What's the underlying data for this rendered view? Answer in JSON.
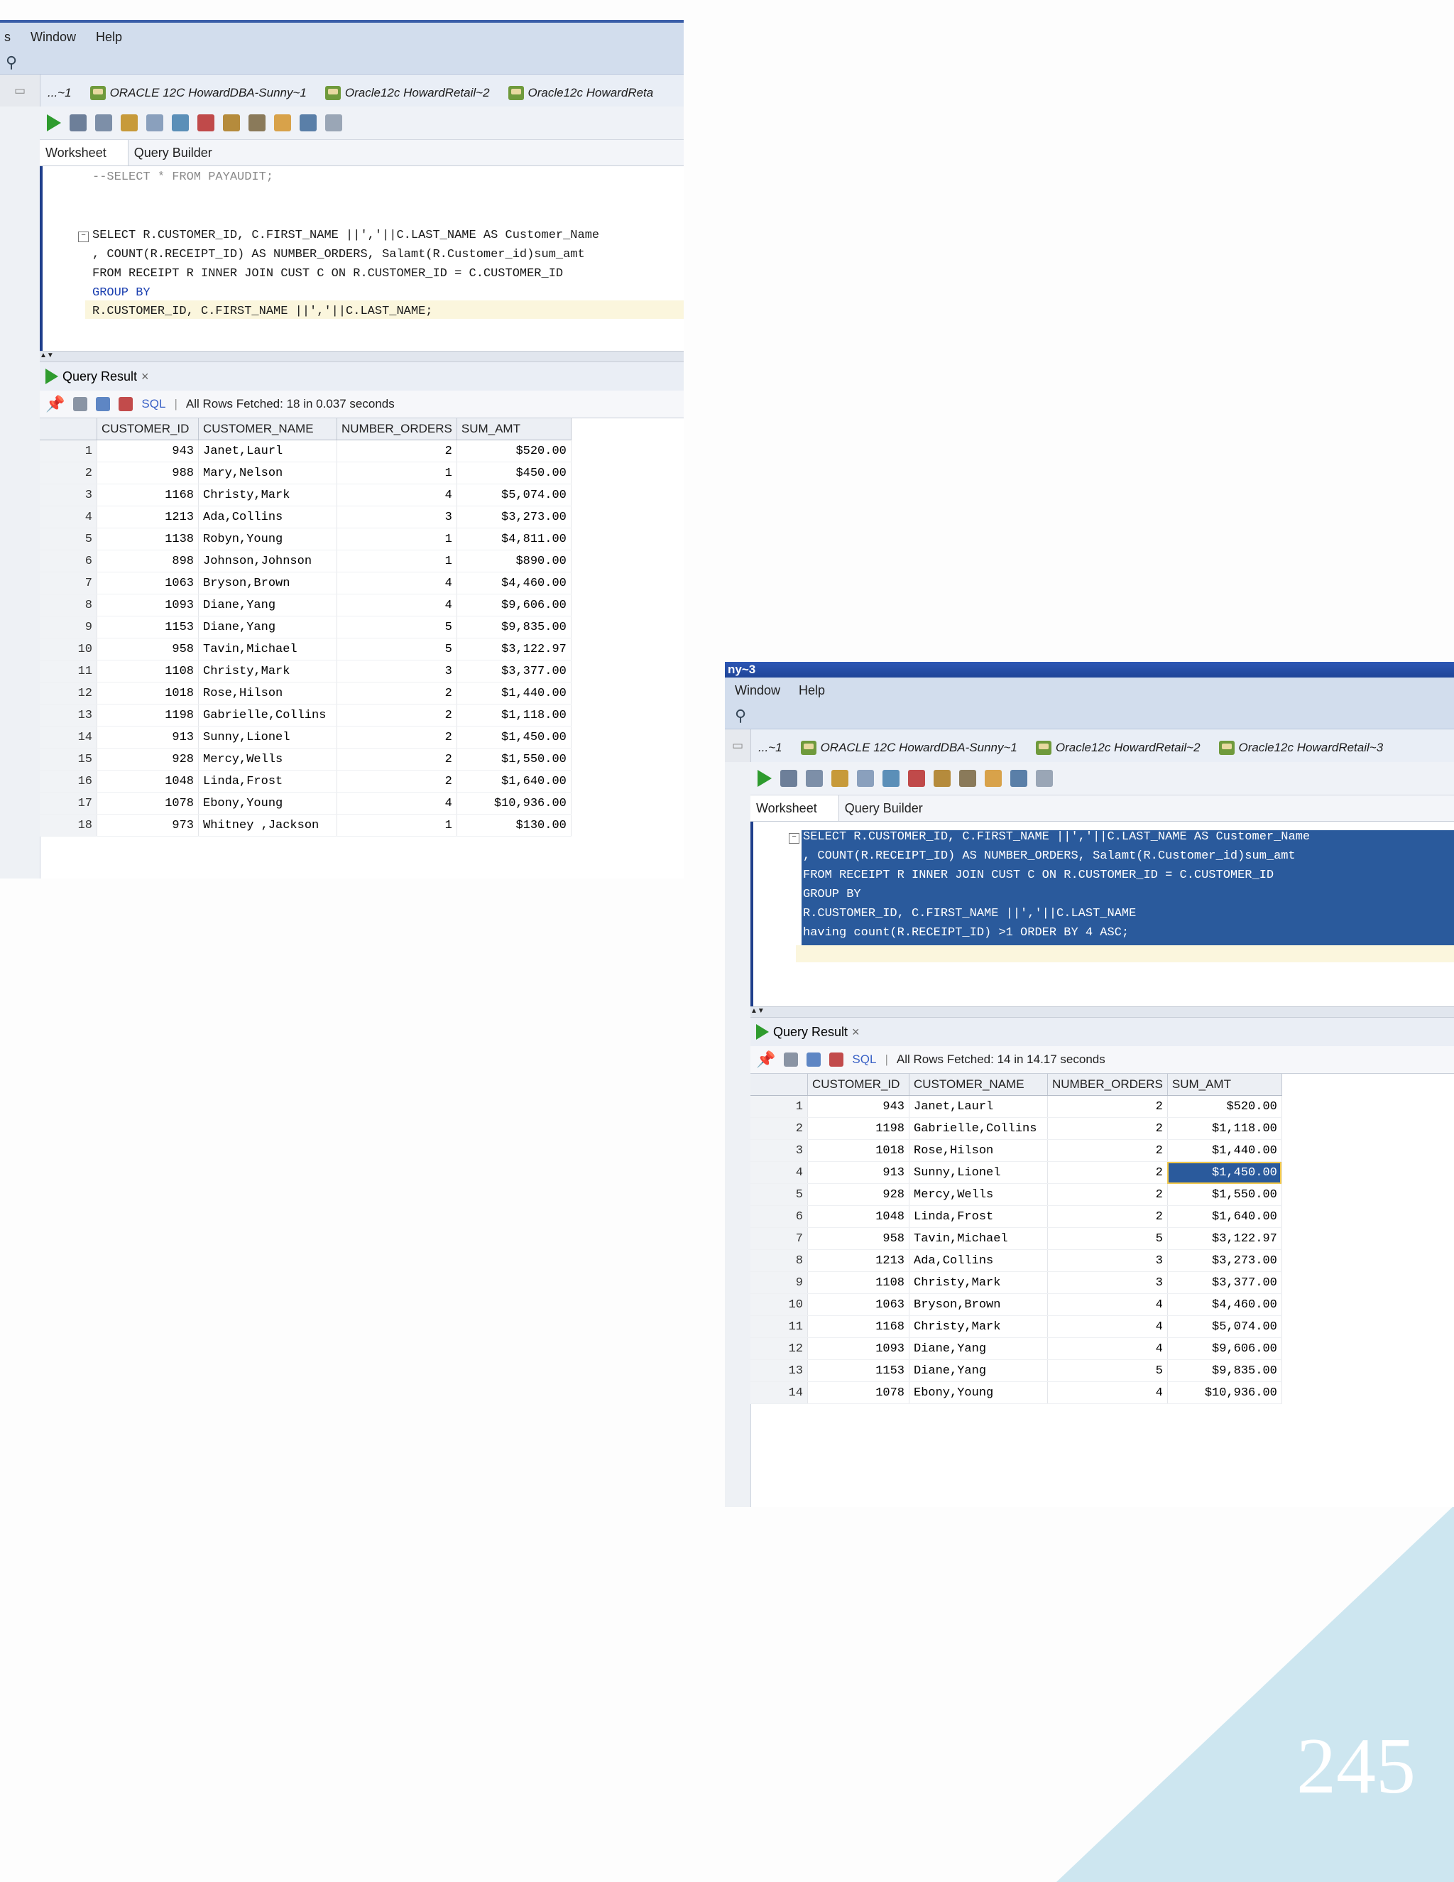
{
  "window1": {
    "menu": [
      "s",
      "Window",
      "Help"
    ],
    "tabs": [
      "...~1",
      "ORACLE 12C HowardDBA-Sunny~1",
      "Oracle12c HowardRetail~2",
      "Oracle12c HowardReta"
    ],
    "subtabs": [
      "Worksheet",
      "Query Builder"
    ],
    "sql": [
      "--SELECT * FROM PAYAUDIT;",
      "",
      "",
      "SELECT R.CUSTOMER_ID, C.FIRST_NAME ||','||C.LAST_NAME AS Customer_Name",
      ", COUNT(R.RECEIPT_ID) AS NUMBER_ORDERS, Salamt(R.Customer_id)sum_amt",
      "FROM RECEIPT R INNER JOIN CUST C ON R.CUSTOMER_ID = C.CUSTOMER_ID",
      "GROUP BY",
      "R.CUSTOMER_ID, C.FIRST_NAME ||','||C.LAST_NAME;"
    ],
    "result_tab": "Query Result",
    "sql_label": "SQL",
    "status": "All Rows Fetched: 18 in 0.037 seconds",
    "columns": [
      "CUSTOMER_ID",
      "CUSTOMER_NAME",
      "NUMBER_ORDERS",
      "SUM_AMT"
    ],
    "rows": [
      [
        "1",
        "943",
        "Janet,Laurl",
        "2",
        "$520.00"
      ],
      [
        "2",
        "988",
        "Mary,Nelson",
        "1",
        "$450.00"
      ],
      [
        "3",
        "1168",
        "Christy,Mark",
        "4",
        "$5,074.00"
      ],
      [
        "4",
        "1213",
        "Ada,Collins",
        "3",
        "$3,273.00"
      ],
      [
        "5",
        "1138",
        "Robyn,Young",
        "1",
        "$4,811.00"
      ],
      [
        "6",
        "898",
        "Johnson,Johnson",
        "1",
        "$890.00"
      ],
      [
        "7",
        "1063",
        "Bryson,Brown",
        "4",
        "$4,460.00"
      ],
      [
        "8",
        "1093",
        "Diane,Yang",
        "4",
        "$9,606.00"
      ],
      [
        "9",
        "1153",
        "Diane,Yang",
        "5",
        "$9,835.00"
      ],
      [
        "10",
        "958",
        "Tavin,Michael",
        "5",
        "$3,122.97"
      ],
      [
        "11",
        "1108",
        "Christy,Mark",
        "3",
        "$3,377.00"
      ],
      [
        "12",
        "1018",
        "Rose,Hilson",
        "2",
        "$1,440.00"
      ],
      [
        "13",
        "1198",
        "Gabrielle,Collins",
        "2",
        "$1,118.00"
      ],
      [
        "14",
        "913",
        "Sunny,Lionel",
        "2",
        "$1,450.00"
      ],
      [
        "15",
        "928",
        "Mercy,Wells",
        "2",
        "$1,550.00"
      ],
      [
        "16",
        "1048",
        "Linda,Frost",
        "2",
        "$1,640.00"
      ],
      [
        "17",
        "1078",
        "Ebony,Young",
        "4",
        "$10,936.00"
      ],
      [
        "18",
        "973",
        "Whitney ,Jackson",
        "1",
        "$130.00"
      ]
    ]
  },
  "window2": {
    "title": "ny~3",
    "menu": [
      "Window",
      "Help"
    ],
    "tabs": [
      "...~1",
      "ORACLE 12C HowardDBA-Sunny~1",
      "Oracle12c HowardRetail~2",
      "Oracle12c HowardRetail~3"
    ],
    "subtabs": [
      "Worksheet",
      "Query Builder"
    ],
    "sql": [
      "SELECT R.CUSTOMER_ID, C.FIRST_NAME ||','||C.LAST_NAME AS Customer_Name",
      ", COUNT(R.RECEIPT_ID) AS NUMBER_ORDERS, Salamt(R.Customer_id)sum_amt",
      "FROM RECEIPT R INNER JOIN CUST C ON R.CUSTOMER_ID = C.CUSTOMER_ID",
      "GROUP BY",
      "R.CUSTOMER_ID, C.FIRST_NAME ||','||C.LAST_NAME",
      "having count(R.RECEIPT_ID) >1 ORDER BY 4 ASC;"
    ],
    "result_tab": "Query Result",
    "sql_label": "SQL",
    "status": "All Rows Fetched: 14 in 14.17 seconds",
    "columns": [
      "CUSTOMER_ID",
      "CUSTOMER_NAME",
      "NUMBER_ORDERS",
      "SUM_AMT"
    ],
    "rows": [
      [
        "1",
        "943",
        "Janet,Laurl",
        "2",
        "$520.00"
      ],
      [
        "2",
        "1198",
        "Gabrielle,Collins",
        "2",
        "$1,118.00"
      ],
      [
        "3",
        "1018",
        "Rose,Hilson",
        "2",
        "$1,440.00"
      ],
      [
        "4",
        "913",
        "Sunny,Lionel",
        "2",
        "$1,450.00"
      ],
      [
        "5",
        "928",
        "Mercy,Wells",
        "2",
        "$1,550.00"
      ],
      [
        "6",
        "1048",
        "Linda,Frost",
        "2",
        "$1,640.00"
      ],
      [
        "7",
        "958",
        "Tavin,Michael",
        "5",
        "$3,122.97"
      ],
      [
        "8",
        "1213",
        "Ada,Collins",
        "3",
        "$3,273.00"
      ],
      [
        "9",
        "1108",
        "Christy,Mark",
        "3",
        "$3,377.00"
      ],
      [
        "10",
        "1063",
        "Bryson,Brown",
        "4",
        "$4,460.00"
      ],
      [
        "11",
        "1168",
        "Christy,Mark",
        "4",
        "$5,074.00"
      ],
      [
        "12",
        "1093",
        "Diane,Yang",
        "4",
        "$9,606.00"
      ],
      [
        "13",
        "1153",
        "Diane,Yang",
        "5",
        "$9,835.00"
      ],
      [
        "14",
        "1078",
        "Ebony,Young",
        "4",
        "$10,936.00"
      ]
    ]
  },
  "page_number": "245",
  "colors": {
    "accent_blue": "#2a5a9c",
    "decor_triangle": "#cde6f0",
    "run_green": "#2e9b2e"
  }
}
